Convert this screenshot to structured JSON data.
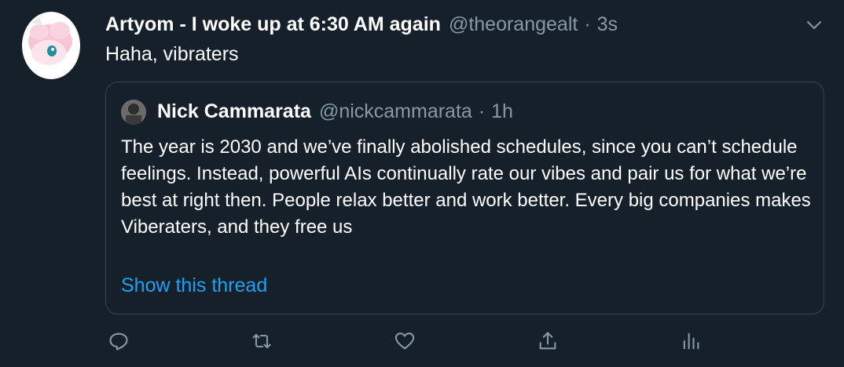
{
  "tweet": {
    "display_name": "Artyom - I woke up at 6:30 AM again",
    "handle": "@theorangealt",
    "separator": "·",
    "time": "3s",
    "text": "Haha, vibraters"
  },
  "quoted_tweet": {
    "display_name": "Nick Cammarata",
    "handle": "@nickcammarata",
    "separator": "·",
    "time": "1h",
    "text": "The year is 2030 and we’ve finally abolished schedules, since you can’t schedule feelings. Instead, powerful AIs continually rate our vibes and pair us for what we’re best at right then. People relax better and work better. Every big companies makes Viberaters, and they free us",
    "show_thread_label": "Show this thread"
  },
  "icons": {
    "caret": "chevron-down-icon",
    "reply": "reply-icon",
    "retweet": "retweet-icon",
    "like": "heart-icon",
    "share": "share-icon",
    "analytics": "analytics-icon"
  },
  "colors": {
    "background": "#15202b",
    "muted": "#8899a6",
    "link": "#1da1f2",
    "border": "#38444d"
  }
}
